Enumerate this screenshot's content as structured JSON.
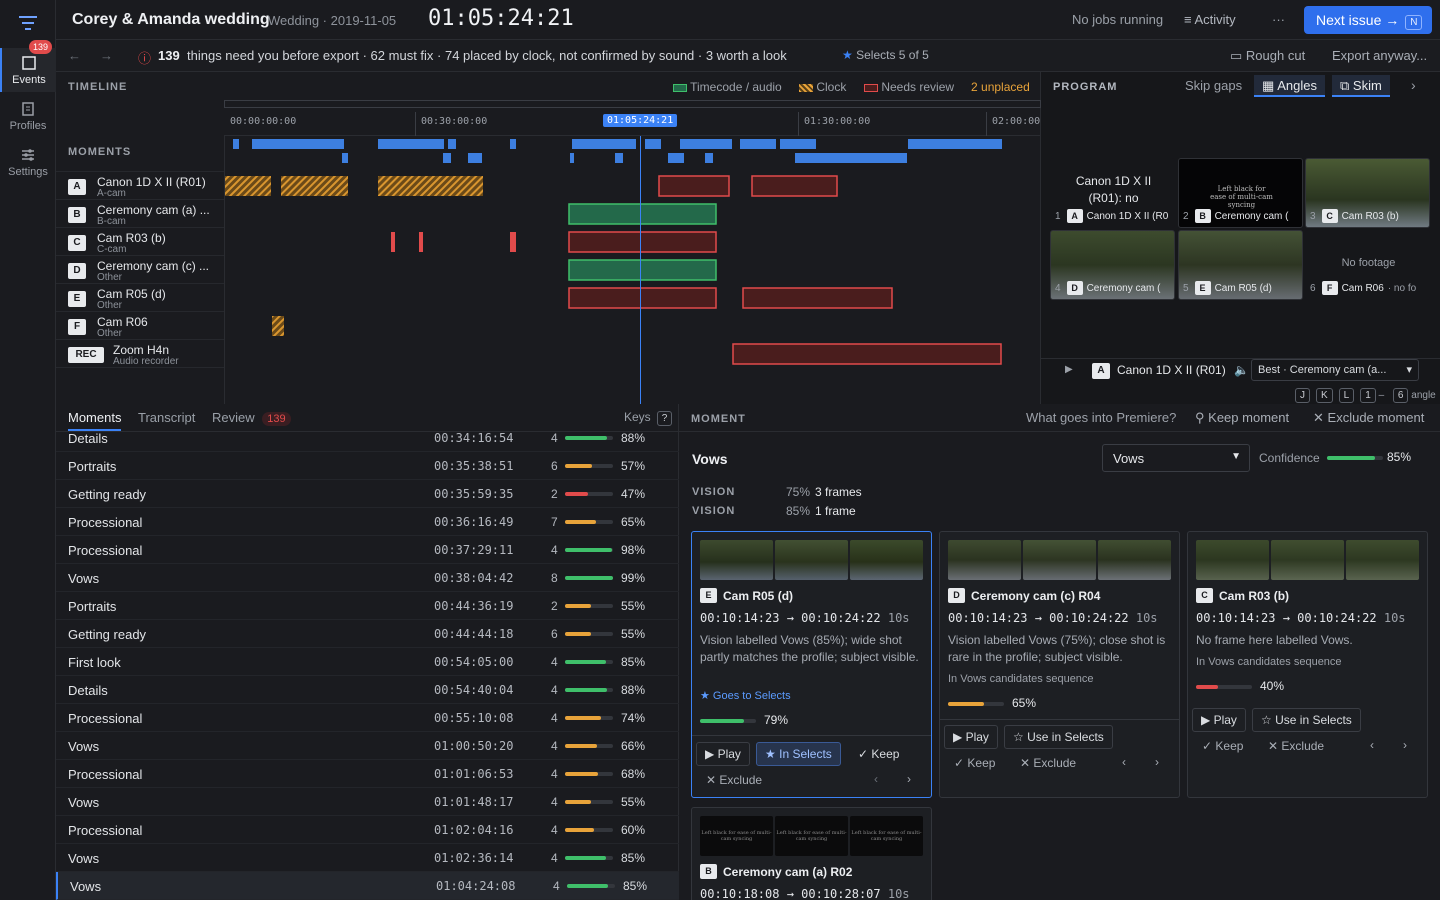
{
  "rail": {
    "items": [
      {
        "label": "Events",
        "badge": "139",
        "active": true
      },
      {
        "label": "Profiles"
      },
      {
        "label": "Settings"
      }
    ]
  },
  "header": {
    "title": "Corey & Amanda wedding",
    "subtitle": "Wedding · 2019-11-05",
    "timecode": "01:05:24:21",
    "jobs": "No jobs running",
    "activity": "Activity",
    "more": "···",
    "next_label": "Next issue →",
    "next_key": "N"
  },
  "subbar": {
    "count": "139",
    "message": "things need you before export · 62 must fix · 74 placed by clock, not confirmed by sound · 3 worth a look",
    "selects": "Selects 5 of 5",
    "rough_cut": "Rough cut",
    "export": "Export anyway..."
  },
  "timeline": {
    "heading": "TIMELINE",
    "legend": {
      "timecode": "Timecode / audio",
      "clock": "Clock",
      "review": "Needs review",
      "unplaced_count": "2",
      "unplaced": "unplaced"
    },
    "ticks": [
      "00:00:00:00",
      "00:30:00:00",
      "01:30:00:00",
      "02:00:00"
    ],
    "playhead": "01:05:24:21",
    "moments_label": "MOMENTS",
    "lanes": [
      {
        "badge": "A",
        "name": "Canon 1D X II (R01)",
        "role": "A-cam"
      },
      {
        "badge": "B",
        "name": "Ceremony cam (a) ...",
        "role": "B-cam"
      },
      {
        "badge": "C",
        "name": "Cam R03 (b)",
        "role": "C-cam"
      },
      {
        "badge": "D",
        "name": "Ceremony cam (c) ...",
        "role": "Other"
      },
      {
        "badge": "E",
        "name": "Cam R05 (d)",
        "role": "Other"
      },
      {
        "badge": "F",
        "name": "Cam R06",
        "role": "Other"
      },
      {
        "badge": "REC",
        "name": "Zoom H4n",
        "role": "Audio recorder"
      }
    ]
  },
  "program": {
    "heading": "PROGRAM",
    "skip_gaps": "Skip gaps",
    "angles": "Angles",
    "skim": "Skim",
    "tiles": [
      {
        "num": "1",
        "badge": "A",
        "label": "Canon 1D X II (R0",
        "overlay": "Canon 1D X II (R01): no"
      },
      {
        "num": "2",
        "badge": "B",
        "label": "Ceremony cam (",
        "overlay": "Left black for ease of multi-cam syncing"
      },
      {
        "num": "3",
        "badge": "C",
        "label": "Cam R03 (b)"
      },
      {
        "num": "4",
        "badge": "D",
        "label": "Ceremony cam ("
      },
      {
        "num": "5",
        "badge": "E",
        "label": "Cam R05 (d)"
      },
      {
        "num": "6",
        "badge": "F",
        "label": "Cam R06",
        "suffix": "· no fo",
        "overlay": "No footage"
      }
    ],
    "current_badge": "A",
    "current_name": "Canon 1D X II (R01)",
    "best": "Best · Ceremony cam (a...",
    "keys": [
      "J",
      "K",
      "L",
      "1",
      "–",
      "6"
    ],
    "keys_suffix": "angle"
  },
  "moments_panel": {
    "tabs": [
      {
        "label": "Moments",
        "active": true
      },
      {
        "label": "Transcript"
      },
      {
        "label": "Review",
        "badge": "139"
      }
    ],
    "keys_label": "Keys",
    "keys_key": "?",
    "rows": [
      {
        "name": "Details",
        "tc": "00:34:16:54",
        "count": "4",
        "pct": "88%",
        "level": 0.88,
        "color": "#3fbf6a"
      },
      {
        "name": "Portraits",
        "tc": "00:35:38:51",
        "count": "6",
        "pct": "57%",
        "level": 0.57,
        "color": "#e8a33a"
      },
      {
        "name": "Getting ready",
        "tc": "00:35:59:35",
        "count": "2",
        "pct": "47%",
        "level": 0.47,
        "color": "#e14b4b"
      },
      {
        "name": "Processional",
        "tc": "00:36:16:49",
        "count": "7",
        "pct": "65%",
        "level": 0.65,
        "color": "#e8a33a"
      },
      {
        "name": "Processional",
        "tc": "00:37:29:11",
        "count": "4",
        "pct": "98%",
        "level": 0.98,
        "color": "#3fbf6a"
      },
      {
        "name": "Vows",
        "tc": "00:38:04:42",
        "count": "8",
        "pct": "99%",
        "level": 0.99,
        "color": "#3fbf6a"
      },
      {
        "name": "Portraits",
        "tc": "00:44:36:19",
        "count": "2",
        "pct": "55%",
        "level": 0.55,
        "color": "#e8a33a"
      },
      {
        "name": "Getting ready",
        "tc": "00:44:44:18",
        "count": "6",
        "pct": "55%",
        "level": 0.55,
        "color": "#e8a33a"
      },
      {
        "name": "First look",
        "tc": "00:54:05:00",
        "count": "4",
        "pct": "85%",
        "level": 0.85,
        "color": "#3fbf6a"
      },
      {
        "name": "Details",
        "tc": "00:54:40:04",
        "count": "4",
        "pct": "88%",
        "level": 0.88,
        "color": "#3fbf6a"
      },
      {
        "name": "Processional",
        "tc": "00:55:10:08",
        "count": "4",
        "pct": "74%",
        "level": 0.74,
        "color": "#e8a33a"
      },
      {
        "name": "Vows",
        "tc": "01:00:50:20",
        "count": "4",
        "pct": "66%",
        "level": 0.66,
        "color": "#e8a33a"
      },
      {
        "name": "Processional",
        "tc": "01:01:06:53",
        "count": "4",
        "pct": "68%",
        "level": 0.68,
        "color": "#e8a33a"
      },
      {
        "name": "Vows",
        "tc": "01:01:48:17",
        "count": "4",
        "pct": "55%",
        "level": 0.55,
        "color": "#e8a33a"
      },
      {
        "name": "Processional",
        "tc": "01:02:04:16",
        "count": "4",
        "pct": "60%",
        "level": 0.6,
        "color": "#e8a33a"
      },
      {
        "name": "Vows",
        "tc": "01:02:36:14",
        "count": "4",
        "pct": "85%",
        "level": 0.85,
        "color": "#3fbf6a"
      },
      {
        "name": "Vows",
        "tc": "01:04:24:08",
        "count": "4",
        "pct": "85%",
        "level": 0.85,
        "color": "#3fbf6a",
        "selected": true
      }
    ]
  },
  "moment": {
    "heading": "MOMENT",
    "premiere": "What goes into Premiere?",
    "keep_moment": "Keep moment",
    "exclude_moment": "Exclude moment",
    "name": "Vows",
    "select_value": "Vows",
    "confidence_label": "Confidence",
    "confidence": "85%",
    "confidence_level": 0.85,
    "vision": [
      {
        "label": "VISION",
        "pct": "75%",
        "frames": "3 frames"
      },
      {
        "label": "VISION",
        "pct": "85%",
        "frames": "1 frame"
      }
    ],
    "cards": [
      {
        "badge": "E",
        "name": "Cam R05 (d)",
        "range": "00:10:14:23 → 00:10:24:22",
        "dur": "10s",
        "desc": "Vision labelled Vows (85%); wide shot partly matches the profile; subject visible.",
        "note": "★ Goes to Selects",
        "pct": "79%",
        "level": 0.79,
        "play": "Play",
        "select_btn": "In Selects",
        "keep": "Keep",
        "exclude": "Exclude"
      },
      {
        "badge": "D",
        "name": "Ceremony cam (c) R04",
        "range": "00:10:14:23 → 00:10:24:22",
        "dur": "10s",
        "desc": "Vision labelled Vows (75%); close shot is rare in the profile; subject visible.",
        "sub": "In Vows candidates sequence",
        "pct": "65%",
        "level": 0.65,
        "play": "Play",
        "select_btn": "Use in Selects",
        "keep": "Keep",
        "exclude": "Exclude"
      },
      {
        "badge": "C",
        "name": "Cam R03 (b)",
        "range": "00:10:14:23 → 00:10:24:22",
        "dur": "10s",
        "desc": "No frame here labelled Vows.",
        "sub": "In Vows candidates sequence",
        "pct": "40%",
        "level": 0.4,
        "play": "Play",
        "select_btn": "Use in Selects",
        "keep": "Keep",
        "exclude": "Exclude"
      },
      {
        "badge": "B",
        "name": "Ceremony cam (a) R02",
        "range": "00:10:18:08 → 00:10:28:07",
        "dur": "10s",
        "overlay": "Left black for ease of multi-cam syncing"
      }
    ]
  },
  "colors": {
    "accent": "#2f6fed",
    "green": "#3fbf6a",
    "amber": "#e8a33a",
    "red": "#e14b4b",
    "blue_clip": "#3d7fe0",
    "green_clip": "#23694a"
  }
}
